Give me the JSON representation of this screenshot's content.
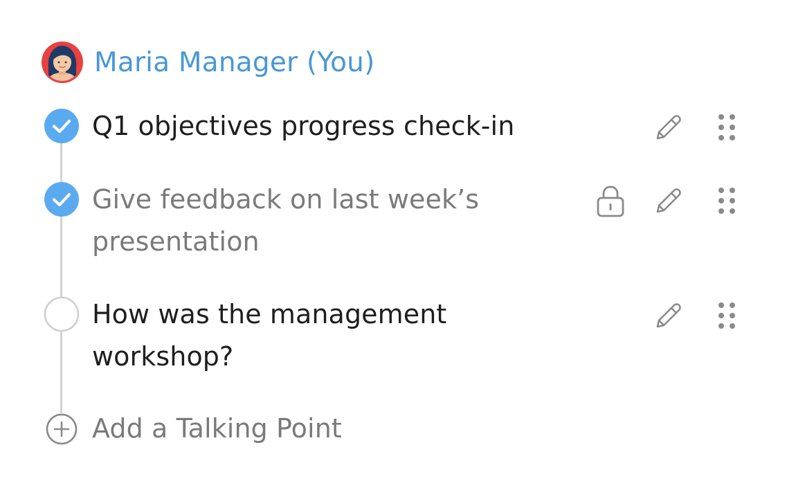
{
  "owner": {
    "name": "Maria Manager (You)",
    "avatar_icon": "avatar-woman-icon",
    "name_color": "#4a98d3",
    "avatar_ring_color": "#e8413f"
  },
  "talking_points": [
    {
      "text": "Q1 objectives progress check-in",
      "status": "completed",
      "private": false,
      "marker_icon": "check-circle-icon"
    },
    {
      "text": "Give feedback on last week’s presentation",
      "status": "completed",
      "private": true,
      "marker_icon": "check-circle-icon",
      "lock_icon": "lock-icon"
    },
    {
      "text": "How was the management workshop?",
      "status": "open",
      "private": false,
      "marker_icon": "empty-circle-icon"
    }
  ],
  "add": {
    "label": "Add a Talking Point",
    "icon": "plus-circle-icon"
  },
  "icons": {
    "edit": "pencil-icon",
    "drag": "drag-handle-icon",
    "lock": "lock-icon"
  },
  "colors": {
    "check_fill": "#5aaaf0",
    "rail": "#d3d3d3",
    "muted_text": "#7a7a7a",
    "text": "#1e1e1e",
    "icon_gray": "#8a8a8a"
  }
}
